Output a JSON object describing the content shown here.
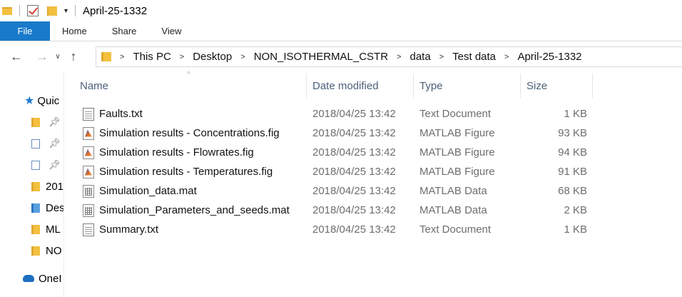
{
  "window": {
    "title": "April-25-1332"
  },
  "ribbon": {
    "tabs": [
      {
        "label": "File"
      },
      {
        "label": "Home"
      },
      {
        "label": "Share"
      },
      {
        "label": "View"
      }
    ]
  },
  "address": {
    "crumbs": [
      "This PC",
      "Desktop",
      "NON_ISOTHERMAL_CSTR",
      "data",
      "Test data",
      "April-25-1332"
    ]
  },
  "nav_pane": {
    "items": [
      {
        "label": "Quic",
        "icon": "star-icon"
      },
      {
        "label": "",
        "icon": "downloads-folder-icon"
      },
      {
        "label": "",
        "icon": "documents-folder-icon"
      },
      {
        "label": "",
        "icon": "pictures-folder-icon"
      },
      {
        "label": "201",
        "icon": "folder-icon"
      },
      {
        "label": "Des",
        "icon": "desktop-folder-icon"
      },
      {
        "label": "ML",
        "icon": "folder-icon"
      },
      {
        "label": "NO",
        "icon": "folder-icon"
      },
      {
        "label": "OneI",
        "icon": "onedrive-cloud-icon"
      }
    ]
  },
  "columns": {
    "name": "Name",
    "date": "Date modified",
    "type": "Type",
    "size": "Size"
  },
  "files": [
    {
      "name": "Faults.txt",
      "date": "2018/04/25 13:42",
      "type": "Text Document",
      "size": "1 KB",
      "icon": "text-file-icon"
    },
    {
      "name": "Simulation results - Concentrations.fig",
      "date": "2018/04/25 13:42",
      "type": "MATLAB Figure",
      "size": "93 KB",
      "icon": "matlab-figure-icon"
    },
    {
      "name": "Simulation results - Flowrates.fig",
      "date": "2018/04/25 13:42",
      "type": "MATLAB Figure",
      "size": "94 KB",
      "icon": "matlab-figure-icon"
    },
    {
      "name": "Simulation results - Temperatures.fig",
      "date": "2018/04/25 13:42",
      "type": "MATLAB Figure",
      "size": "91 KB",
      "icon": "matlab-figure-icon"
    },
    {
      "name": "Simulation_data.mat",
      "date": "2018/04/25 13:42",
      "type": "MATLAB Data",
      "size": "68 KB",
      "icon": "matlab-data-icon"
    },
    {
      "name": "Simulation_Parameters_and_seeds.mat",
      "date": "2018/04/25 13:42",
      "type": "MATLAB Data",
      "size": "2 KB",
      "icon": "matlab-data-icon"
    },
    {
      "name": "Summary.txt",
      "date": "2018/04/25 13:42",
      "type": "Text Document",
      "size": "1 KB",
      "icon": "text-file-icon"
    }
  ],
  "colors": {
    "accent": "#1979ca",
    "folder": "#f3c03f",
    "header_text": "#4c607a"
  }
}
